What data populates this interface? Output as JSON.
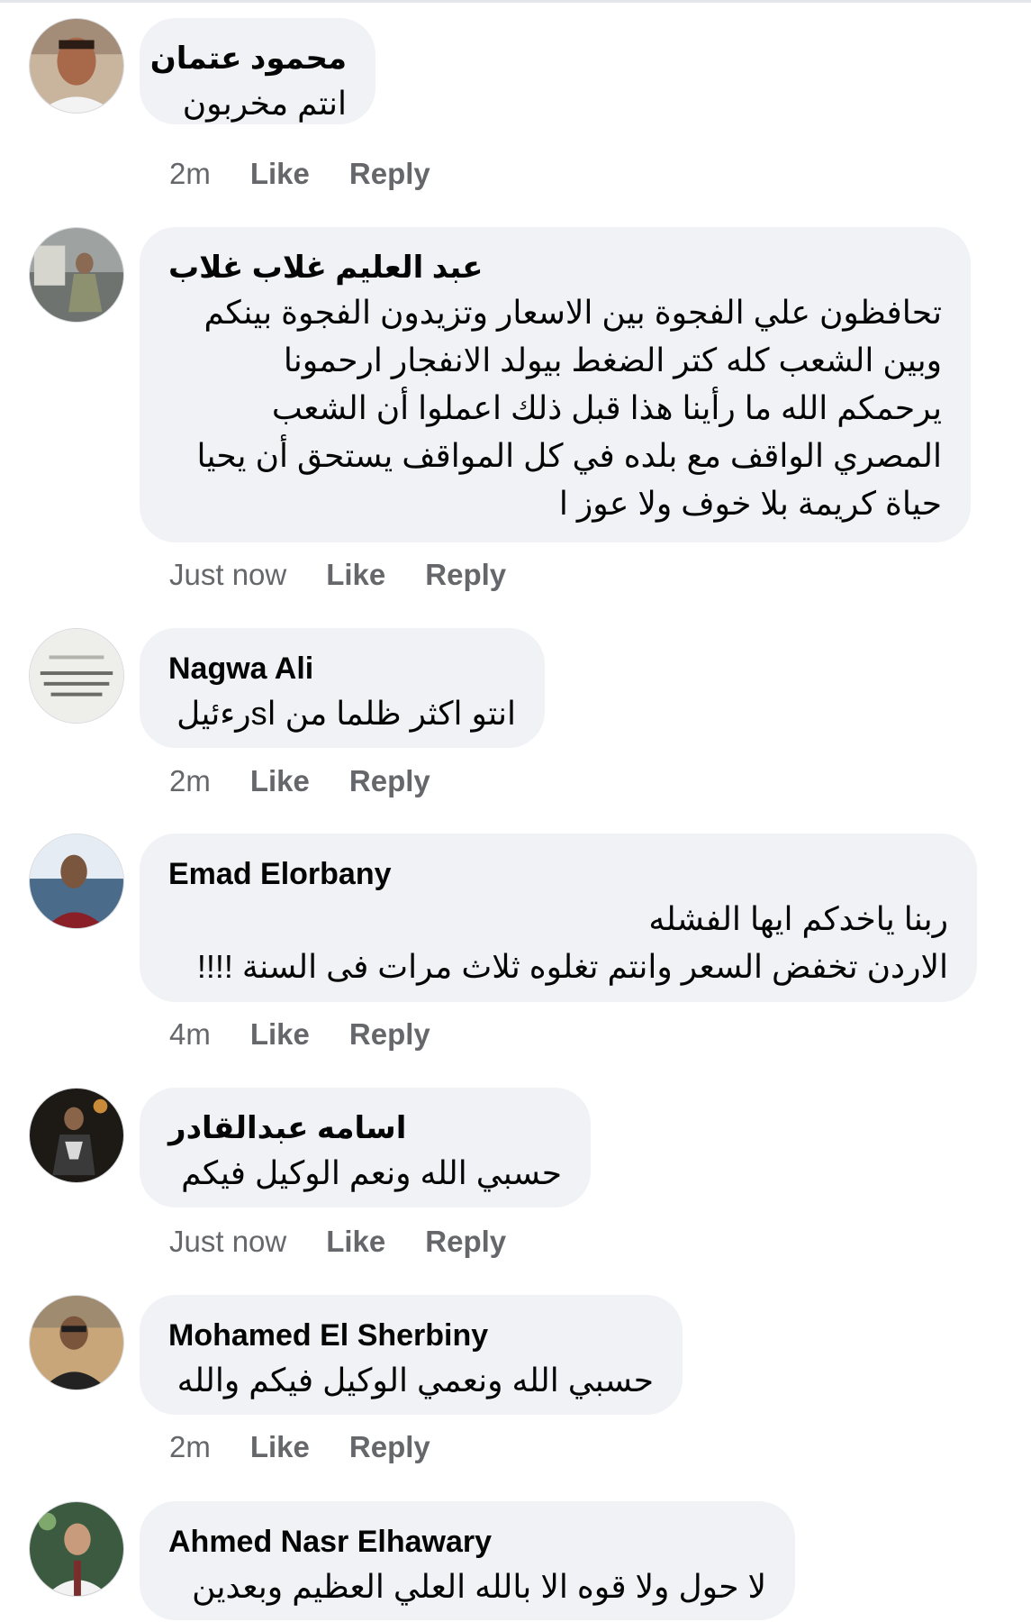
{
  "action_labels": {
    "like": "Like",
    "reply": "Reply"
  },
  "comments": [
    {
      "author": "محمود عتمان",
      "lines": [
        "انتم مخربون"
      ],
      "time": "2m"
    },
    {
      "author": "عبد العليم غلاب غلاب",
      "lines": [
        "تحافظون علي الفجوة بين الاسعار وتزيدون الفجوة بينكم",
        "وبين الشعب كله كتر الضغط بيولد الانفجار ارحمونا",
        "يرحمكم الله ما رأينا هذا قبل ذلك اعملوا أن الشعب",
        "المصري الواقف مع بلده في كل المواقف يستحق أن يحيا",
        "حياة كريمة بلا خوف ولا عوز ا"
      ],
      "time": "Just now"
    },
    {
      "author": "Nagwa Ali",
      "lines": [
        "انتو اكثر ظلما من اsرءئيل"
      ],
      "time": "2m"
    },
    {
      "author": "Emad Elorbany",
      "lines": [
        "ربنا ياخدكم ايها الفشله",
        "الاردن تخفض السعر وانتم تغلوه ثلاث مرات فى السنة !!!!"
      ],
      "time": "4m"
    },
    {
      "author": "اسامه عبدالقادر",
      "lines": [
        "حسبي الله ونعم الوكيل فيكم"
      ],
      "time": "Just now"
    },
    {
      "author": "Mohamed El Sherbiny",
      "lines": [
        "حسبي الله ونعمي الوكيل فيكم والله"
      ],
      "time": "2m"
    },
    {
      "author": "Ahmed Nasr Elhawary",
      "lines": [
        "لا حول ولا قوه الا بالله العلي العظيم وبعدين"
      ],
      "time": ""
    }
  ]
}
